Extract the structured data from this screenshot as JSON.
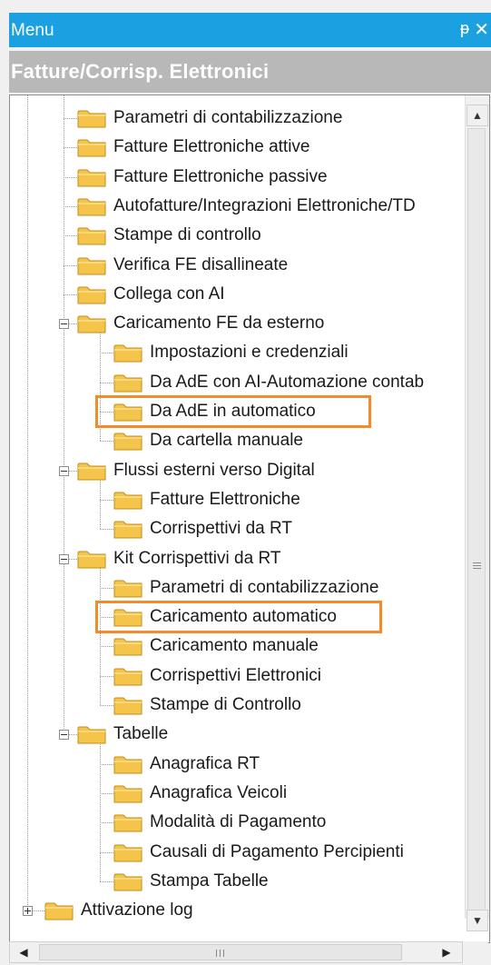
{
  "window": {
    "title": "Menu",
    "pin_glyph": "ᵽ",
    "close_glyph": "✕"
  },
  "section": {
    "title": "Fatture/Corrisp. Elettronici"
  },
  "colors": {
    "titlebar": "#1ba1e2",
    "section_header": "#b8b8b8",
    "highlight": "#f28c2a",
    "folder": "#f5c44a"
  },
  "tree": {
    "items": [
      {
        "label": "Parametri di contabilizzazione",
        "level": 1
      },
      {
        "label": "Fatture Elettroniche attive",
        "level": 1
      },
      {
        "label": "Fatture Elettroniche passive",
        "level": 1
      },
      {
        "label": "Autofatture/Integrazioni Elettroniche/TD",
        "level": 1
      },
      {
        "label": "Stampe di controllo",
        "level": 1
      },
      {
        "label": "Verifica FE disallineate",
        "level": 1
      },
      {
        "label": "Collega con AI",
        "level": 1
      },
      {
        "label": "Caricamento FE da esterno",
        "level": 1,
        "expanded": true
      },
      {
        "label": "Impostazioni e credenziali",
        "level": 2
      },
      {
        "label": "Da AdE con AI-Automazione contab",
        "level": 2
      },
      {
        "label": "Da AdE in automatico",
        "level": 2,
        "highlighted": true
      },
      {
        "label": "Da cartella manuale",
        "level": 2
      },
      {
        "label": "Flussi esterni verso Digital",
        "level": 1,
        "expanded": true
      },
      {
        "label": "Fatture Elettroniche",
        "level": 2
      },
      {
        "label": "Corrispettivi da RT",
        "level": 2
      },
      {
        "label": "Kit Corrispettivi da RT",
        "level": 1,
        "expanded": true
      },
      {
        "label": "Parametri di contabilizzazione",
        "level": 2
      },
      {
        "label": "Caricamento automatico",
        "level": 2,
        "highlighted": true
      },
      {
        "label": "Caricamento manuale",
        "level": 2
      },
      {
        "label": "Corrispettivi Elettronici",
        "level": 2
      },
      {
        "label": "Stampe di Controllo",
        "level": 2
      },
      {
        "label": "Tabelle",
        "level": 1,
        "expanded": true
      },
      {
        "label": "Anagrafica RT",
        "level": 2
      },
      {
        "label": "Anagrafica Veicoli",
        "level": 2
      },
      {
        "label": "Modalità di Pagamento",
        "level": 2
      },
      {
        "label": "Causali di Pagamento Percipienti",
        "level": 2
      },
      {
        "label": "Stampa Tabelle",
        "level": 2
      },
      {
        "label": "Attivazione log",
        "level": 0,
        "expanded": false
      }
    ]
  },
  "scrollbar": {
    "up_glyph": "▲",
    "down_glyph": "▼",
    "left_glyph": "◀",
    "right_glyph": "▶"
  }
}
